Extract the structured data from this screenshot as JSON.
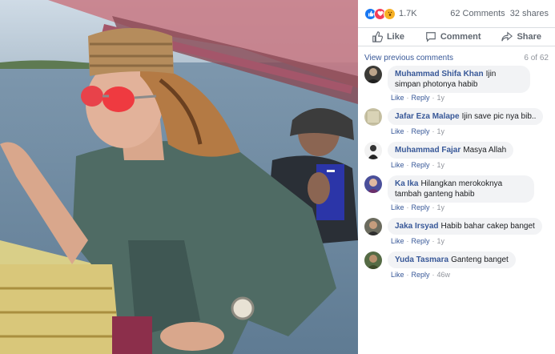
{
  "post": {
    "reaction_count": "1.7K",
    "comments_count": "62 Comments",
    "shares_count": "32 shares",
    "reactions": [
      "like-icon",
      "love-icon",
      "wow-icon"
    ],
    "actions": {
      "like": "Like",
      "comment": "Comment",
      "share": "Share"
    }
  },
  "comments_panel": {
    "view_previous": "View previous comments",
    "counter": "6 of 62",
    "items": [
      {
        "name": "Muhammad Shifa Khan",
        "text": "Ijin simpan photonya habib",
        "like": "Like",
        "reply": "Reply",
        "age": "1y"
      },
      {
        "name": "Jafar Eza Malape",
        "text": "Ijin save pic nya bib..",
        "like": "Like",
        "reply": "Reply",
        "age": "1y"
      },
      {
        "name": "Muhammad Fajar",
        "text": "Masya Allah",
        "like": "Like",
        "reply": "Reply",
        "age": "1y"
      },
      {
        "name": "Ka Ika",
        "text": "Hilangkan merokoknya tambah ganteng habib",
        "like": "Like",
        "reply": "Reply",
        "age": "1y"
      },
      {
        "name": "Jaka Irsyad",
        "text": "Habib bahar cakep banget",
        "like": "Like",
        "reply": "Reply",
        "age": "1y"
      },
      {
        "name": "Yuda Tasmara",
        "text": "Ganteng banget",
        "like": "Like",
        "reply": "Reply",
        "age": "46w"
      }
    ]
  },
  "colors": {
    "link": "#385898",
    "muted": "#606770",
    "bubble": "#f2f3f5",
    "like_blue": "#1877f2",
    "love_red": "#f33e58",
    "wow_yellow": "#f7b125"
  }
}
